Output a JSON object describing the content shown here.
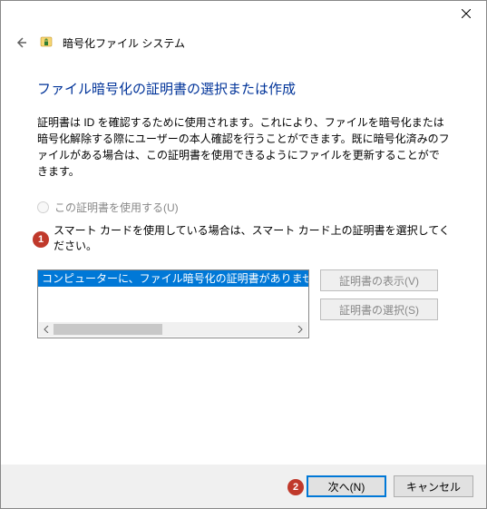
{
  "window": {
    "title": "暗号化ファイル システム"
  },
  "page": {
    "heading": "ファイル暗号化の証明書の選択または作成",
    "description": "証明書は ID を確認するために使用されます。これにより、ファイルを暗号化または暗号化解除する際にユーザーの本人確認を行うことができます。既に暗号化済みのファイルがある場合は、この証明書を使用できるようにファイルを更新することができます。"
  },
  "radio": {
    "use_cert_label": "この証明書を使用する(U)"
  },
  "smartcard_note": "スマート カードを使用している場合は、スマート カード上の証明書を選択してください。",
  "listbox": {
    "selected_item": "コンピューターに、ファイル暗号化の証明書がありません。ファイルを"
  },
  "buttons": {
    "view_cert": "証明書の表示(V)",
    "select_cert": "証明書の選択(S)",
    "next": "次へ(N)",
    "cancel": "キャンセル"
  },
  "annotations": {
    "one": "1",
    "two": "2"
  }
}
